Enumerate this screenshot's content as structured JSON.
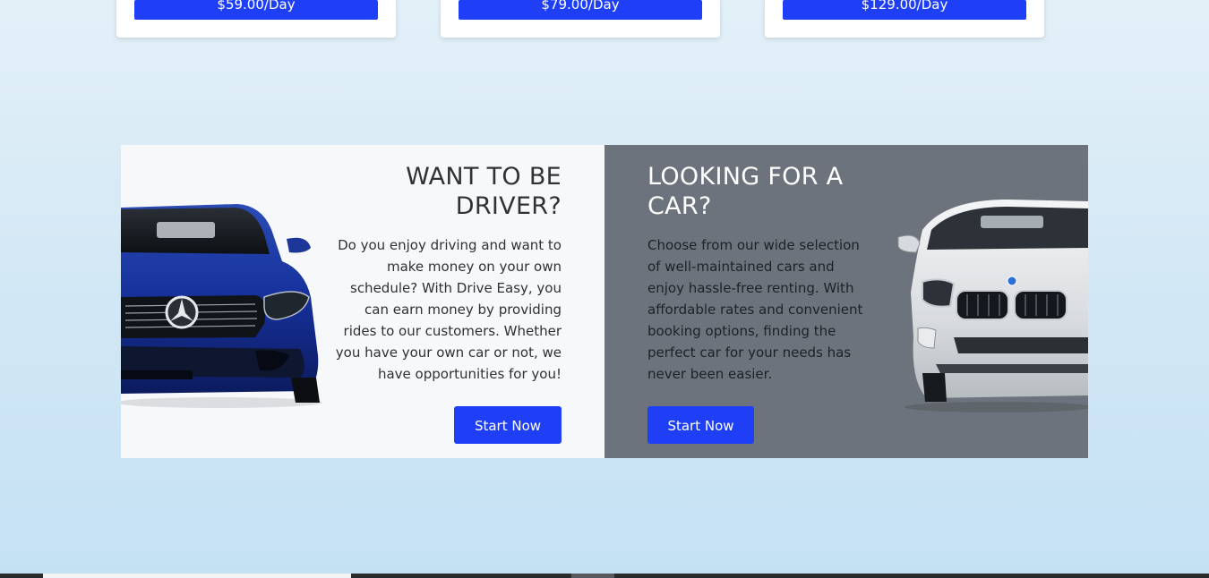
{
  "pricing": {
    "cards": [
      {
        "price_label": "$59.00/Day"
      },
      {
        "price_label": "$79.00/Day"
      },
      {
        "price_label": "$129.00/Day"
      }
    ]
  },
  "driver_banner": {
    "title": "WANT TO BE DRIVER?",
    "description": "Do you enjoy driving and want to make money on your own schedule? With Drive Easy, you can earn money by providing rides to our customers. Whether you have your own car or not, we have opportunities for you!",
    "button_label": "Start Now",
    "image_icon": "blue-mercedes-car-image"
  },
  "car_banner": {
    "title": "LOOKING FOR A CAR?",
    "description": "Choose from our wide selection of well-maintained cars and enjoy hassle-free renting. With affordable rates and convenient booking options, finding the perfect car for your needs has never been easier.",
    "button_label": "Start Now",
    "image_icon": "white-bmw-suv-image"
  },
  "colors": {
    "accent": "#1f3ff6",
    "driver_bg": "#f6f8fa",
    "car_bg": "#6c737c",
    "page_bg": "#d4e8f5"
  }
}
